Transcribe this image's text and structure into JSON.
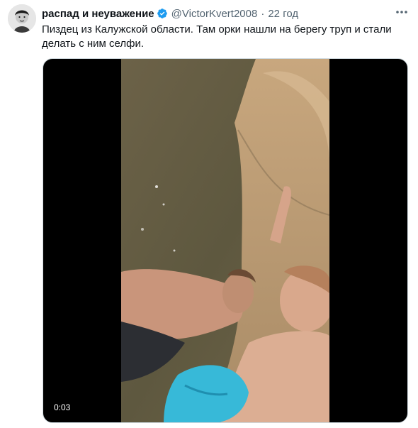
{
  "tweet": {
    "author_name": "распад и неуважение",
    "handle": "@VictorKvert2008",
    "separator": "·",
    "time": "22 год",
    "text": "Пиздец из Калужской области. Там орки нашли на берегу труп и стали делать с ним селфи.",
    "verified": true,
    "media": {
      "type": "video",
      "duration": "0:03"
    }
  },
  "colors": {
    "text_primary": "#0f1419",
    "text_secondary": "#536471",
    "verified_badge": "#1d9bf0",
    "media_background": "#000000"
  },
  "icons": {
    "verified": "verified-badge-icon",
    "more": "more-options-icon",
    "avatar": "profile-avatar"
  }
}
